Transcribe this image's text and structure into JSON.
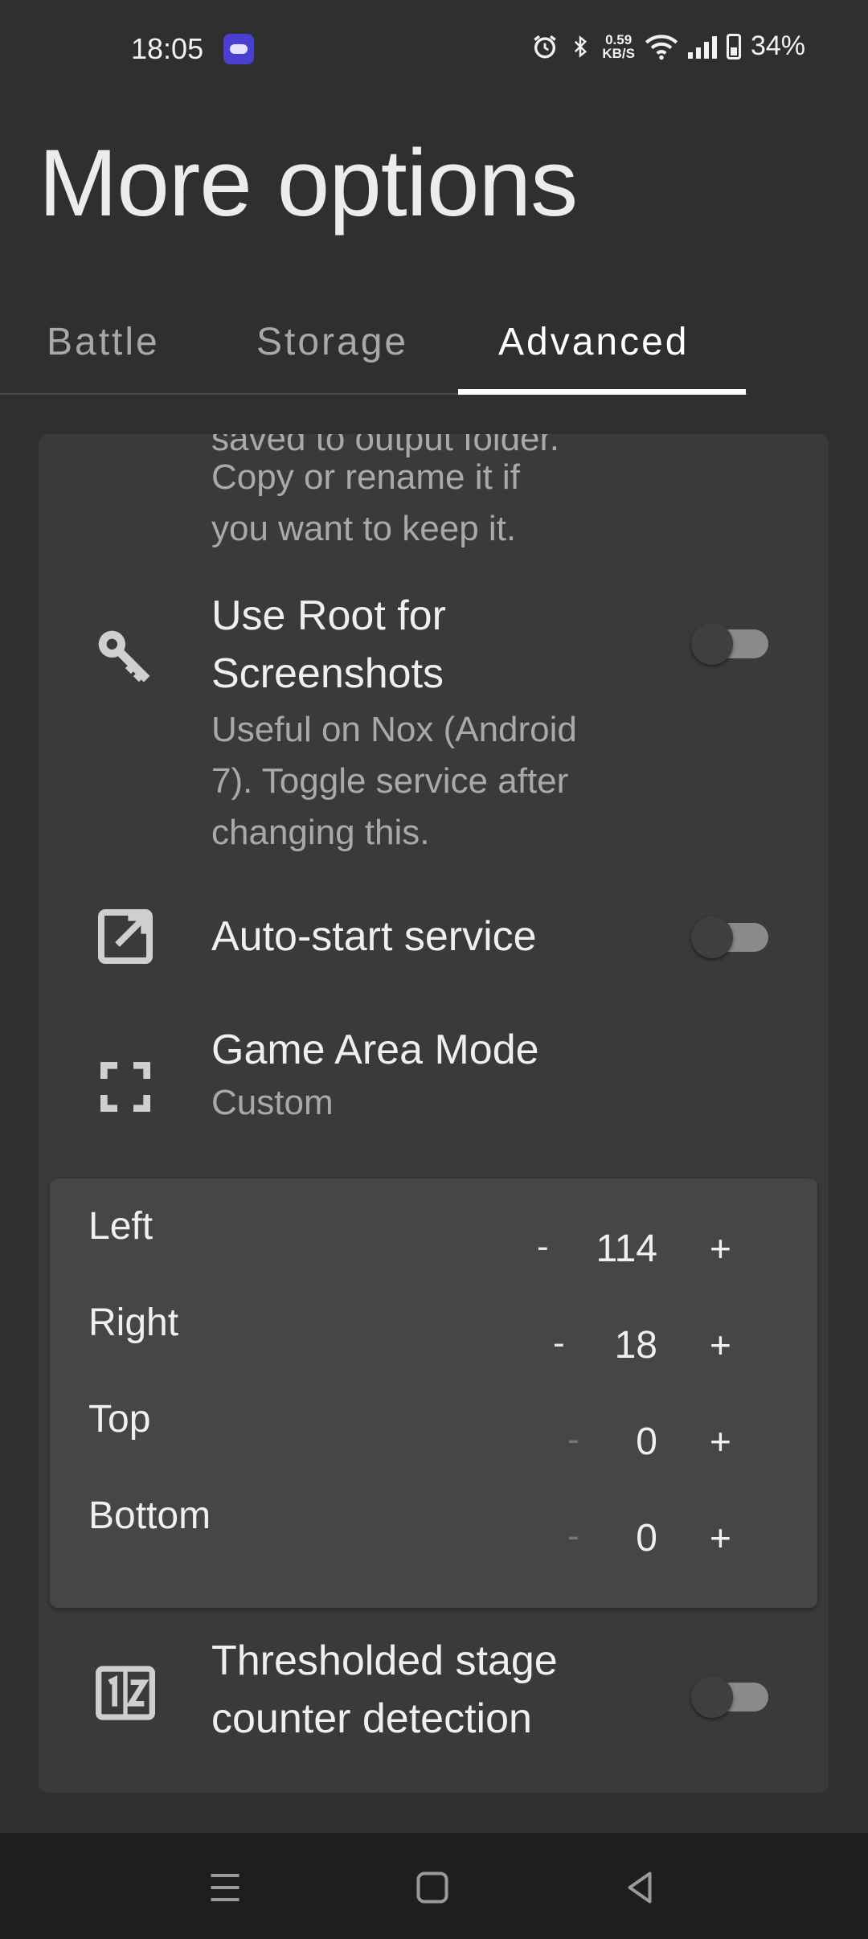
{
  "status_bar": {
    "time": "18:05",
    "net_speed_value": "0.59",
    "net_speed_unit": "KB/S",
    "battery": "34%",
    "icons": [
      "app-notification-icon",
      "alarm-icon",
      "bluetooth-icon",
      "wifi-icon",
      "signal-icon",
      "battery-icon"
    ]
  },
  "page": {
    "title": "More options"
  },
  "tabs": [
    {
      "label": "Battle",
      "selected": false
    },
    {
      "label": "Storage",
      "selected": false
    },
    {
      "label": "Advanced",
      "selected": true
    }
  ],
  "settings": {
    "partial_desc_line1": "saved to output folder.",
    "partial_desc_line2": "Copy or rename it if",
    "partial_desc_line3": "you want to keep it.",
    "root_screenshots": {
      "icon": "key-icon",
      "title_line1": "Use Root for",
      "title_line2": "Screenshots",
      "desc_line1": "Useful on Nox (Android",
      "desc_line2": "7). Toggle service after",
      "desc_line3": "changing this.",
      "enabled": false
    },
    "auto_start": {
      "icon": "open-in-new-icon",
      "title": "Auto-start service",
      "enabled": false
    },
    "game_area_mode": {
      "icon": "fullscreen-icon",
      "title": "Game Area Mode",
      "value": "Custom"
    },
    "game_area": [
      {
        "label": "Left",
        "minus": "-",
        "value": "114",
        "plus": "+"
      },
      {
        "label": "Right",
        "minus": "-",
        "value": "18",
        "plus": "+"
      },
      {
        "label": "Top",
        "minus": "-",
        "value": "0",
        "plus": "+"
      },
      {
        "label": "Bottom",
        "minus": "-",
        "value": "0",
        "plus": "+"
      }
    ],
    "stage_counter": {
      "icon": "numbers-icon",
      "title_line1": "Thresholded stage",
      "title_line2": "counter detection",
      "enabled": false
    }
  },
  "nav_bar": {
    "buttons": [
      "menu-icon",
      "home-icon",
      "back-icon"
    ]
  },
  "colors": {
    "background": "#2f2f2f",
    "card": "#3a3a3a",
    "panel": "#464646",
    "text": "#efefef",
    "secondary_text": "#a9a9a9"
  }
}
